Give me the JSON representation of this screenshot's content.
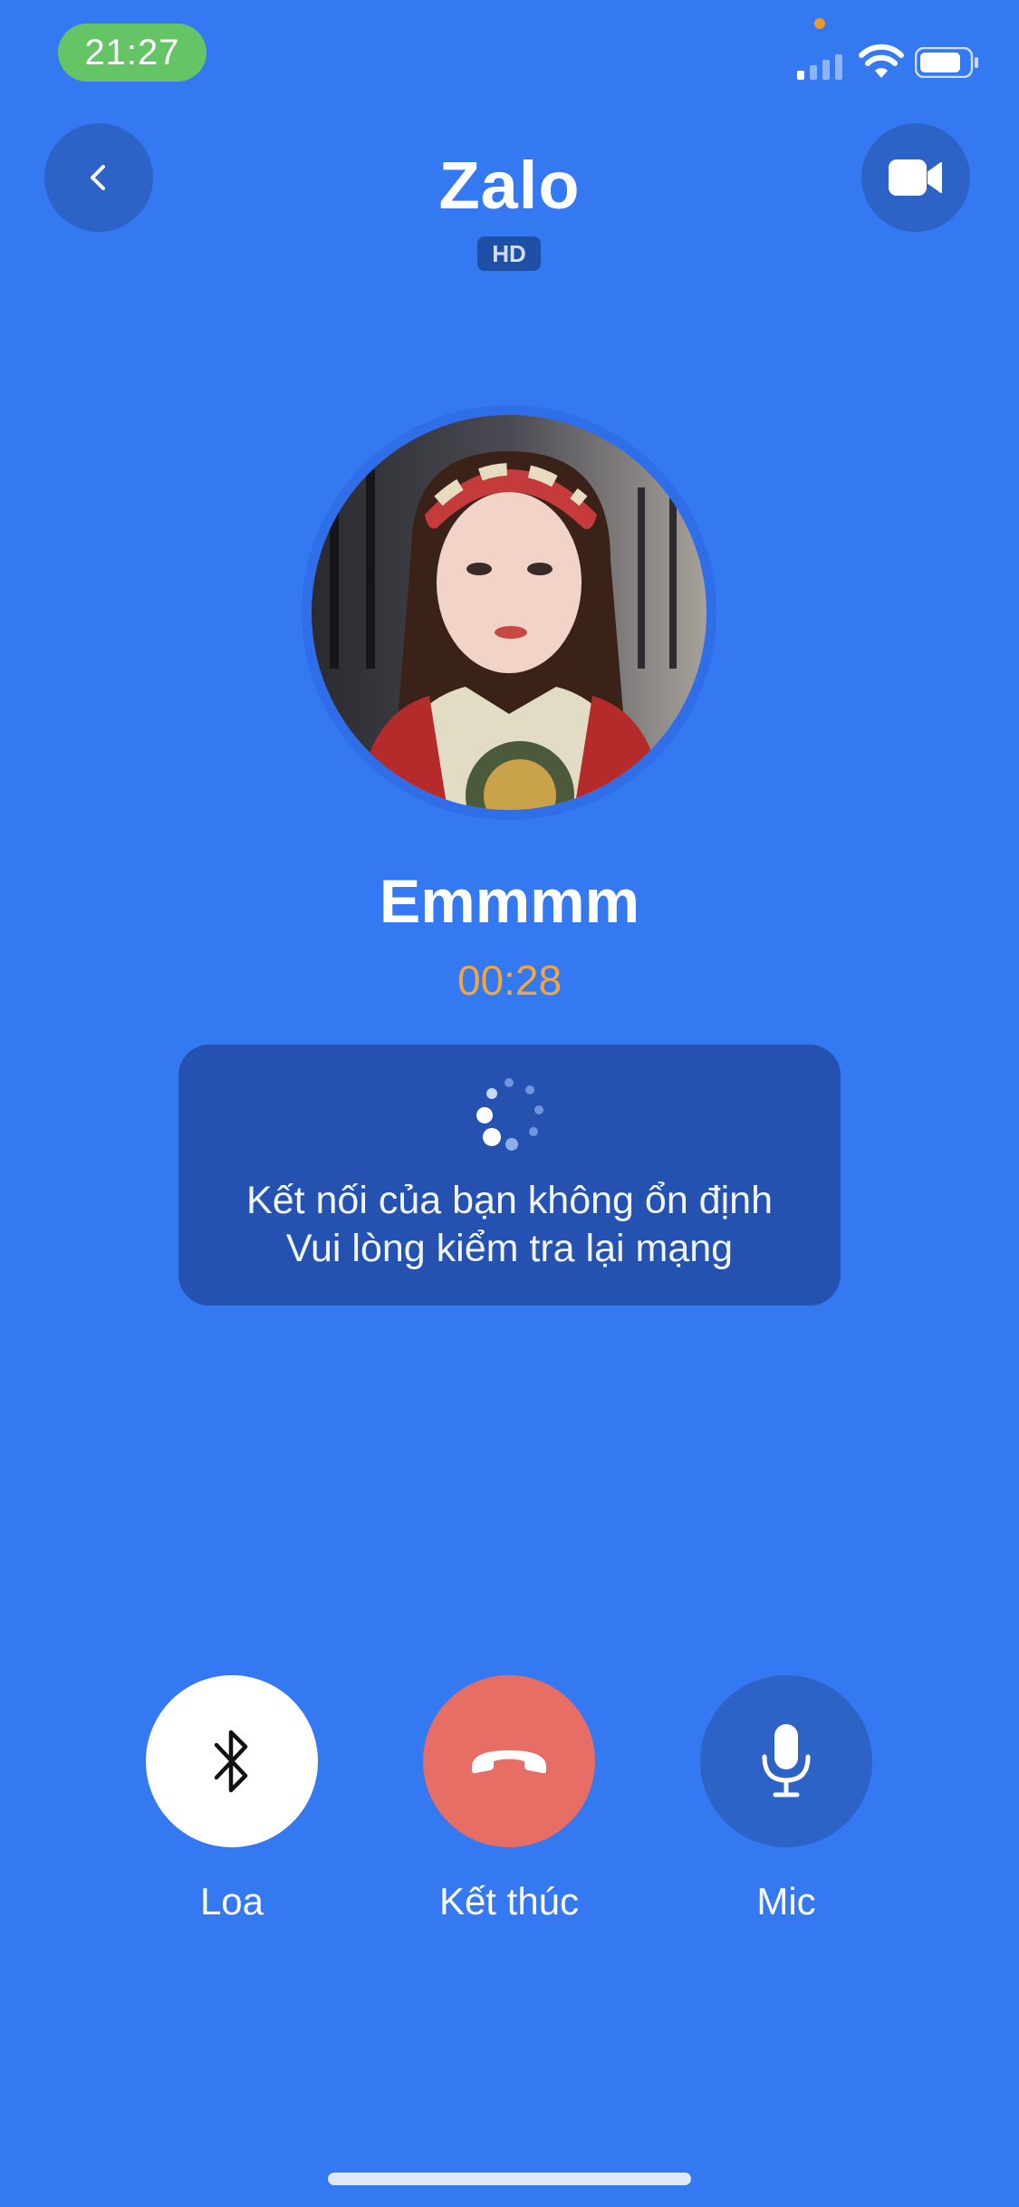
{
  "status_bar": {
    "time": "21:27",
    "time_pill_color": "#64c466"
  },
  "header": {
    "title": "Zalo",
    "quality_badge": "HD",
    "back_icon": "chevron-left-icon",
    "video_icon": "video-camera-icon"
  },
  "call": {
    "contact_name": "Emmmm",
    "duration": "00:28",
    "duration_color": "#f0a640"
  },
  "connection_warning": {
    "line1": "Kết nối của bạn không ổn định",
    "line2": "Vui lòng kiểm tra lại mạng",
    "icon": "loading-spinner-icon"
  },
  "controls": {
    "speaker": {
      "label": "Loa",
      "icon": "bluetooth-icon"
    },
    "end_call": {
      "label": "Kết thúc",
      "icon": "hang-up-icon",
      "color": "#e66e64"
    },
    "mic": {
      "label": "Mic",
      "icon": "microphone-icon"
    }
  },
  "colors": {
    "background": "#3478f2",
    "button_dark": "#2d63c7",
    "warning_box": "#2552b0"
  }
}
